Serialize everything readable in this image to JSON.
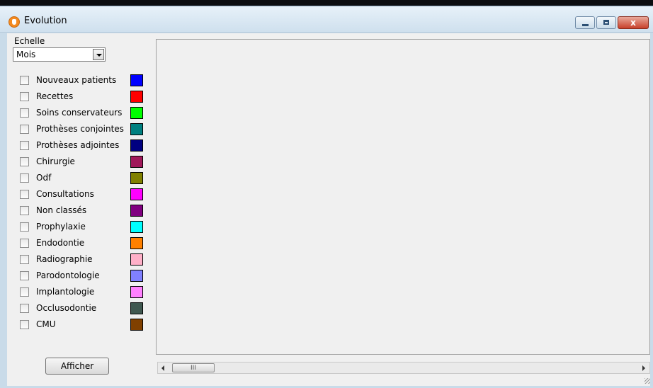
{
  "window": {
    "title": "Evolution",
    "close_glyph": "x",
    "icon": "tooth-app-icon"
  },
  "scale": {
    "label": "Echelle",
    "selected": "Mois"
  },
  "categories": [
    {
      "label": "Nouveaux patients",
      "color": "#0000FF"
    },
    {
      "label": "Recettes",
      "color": "#FF0000"
    },
    {
      "label": "Soins conservateurs",
      "color": "#00FF00"
    },
    {
      "label": "Prothèses conjointes",
      "color": "#008080"
    },
    {
      "label": "Prothèses adjointes",
      "color": "#000080"
    },
    {
      "label": "Chirurgie",
      "color": "#A0185A"
    },
    {
      "label": "Odf",
      "color": "#808000"
    },
    {
      "label": "Consultations",
      "color": "#FF00FF"
    },
    {
      "label": "Non classés",
      "color": "#800080"
    },
    {
      "label": "Prophylaxie",
      "color": "#00FFFF"
    },
    {
      "label": "Endodontie",
      "color": "#FF8000"
    },
    {
      "label": "Radiographie",
      "color": "#FFB0C8"
    },
    {
      "label": "Parodontologie",
      "color": "#8080FF"
    },
    {
      "label": "Implantologie",
      "color": "#FF80FF"
    },
    {
      "label": "Occlusodontie",
      "color": "#405850"
    },
    {
      "label": "CMU",
      "color": "#804000"
    }
  ],
  "actions": {
    "show_label": "Afficher"
  },
  "scrollbar": {
    "thumb_grip": "III"
  }
}
